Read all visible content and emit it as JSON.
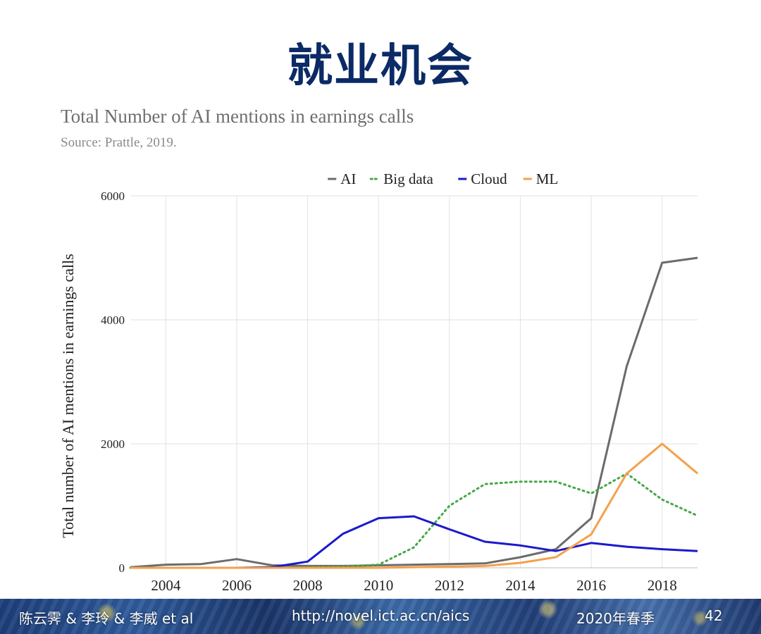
{
  "slide": {
    "title": "就业机会"
  },
  "footer": {
    "authors": "陈云霁 & 李玲 & 李威 et al",
    "url": "http://novel.ict.ac.cn/aics",
    "term": "2020年春季",
    "page": "42"
  },
  "colors": {
    "title": "#0b2a66",
    "AI": "#6b6b6b",
    "Big data": "#45a845",
    "Cloud": "#1a1acc",
    "ML": "#f5a04a"
  },
  "chart_data": {
    "type": "line",
    "title": "Total Number of AI mentions in earnings calls",
    "subtitle": "Source: Prattle, 2019.",
    "xlabel": "",
    "ylabel": "Total number of AI mentions in earnings calls",
    "xlim": [
      2003,
      2019
    ],
    "ylim": [
      0,
      6000
    ],
    "x_ticks": [
      "2004",
      "2006",
      "2008",
      "2010",
      "2012",
      "2014",
      "2016",
      "2018"
    ],
    "y_ticks": [
      "0",
      "2000",
      "4000",
      "6000"
    ],
    "grid": true,
    "legend_position": "top",
    "x": [
      2003,
      2004,
      2005,
      2006,
      2007,
      2008,
      2009,
      2010,
      2011,
      2012,
      2013,
      2014,
      2015,
      2016,
      2017,
      2018,
      2019
    ],
    "series": [
      {
        "name": "AI",
        "style": "solid",
        "values": [
          10,
          50,
          60,
          140,
          40,
          30,
          30,
          40,
          50,
          60,
          70,
          170,
          300,
          800,
          3250,
          4920,
          5000
        ]
      },
      {
        "name": "Big data",
        "style": "dotted",
        "values": [
          0,
          0,
          0,
          0,
          0,
          10,
          20,
          50,
          330,
          1000,
          1350,
          1390,
          1390,
          1200,
          1520,
          1100,
          840
        ]
      },
      {
        "name": "Cloud",
        "style": "solid",
        "values": [
          0,
          0,
          0,
          0,
          10,
          100,
          550,
          800,
          830,
          620,
          420,
          360,
          270,
          400,
          340,
          300,
          270
        ]
      },
      {
        "name": "ML",
        "style": "solid",
        "values": [
          0,
          0,
          0,
          0,
          0,
          0,
          0,
          0,
          10,
          20,
          30,
          80,
          170,
          540,
          1520,
          2000,
          1520
        ]
      }
    ]
  }
}
